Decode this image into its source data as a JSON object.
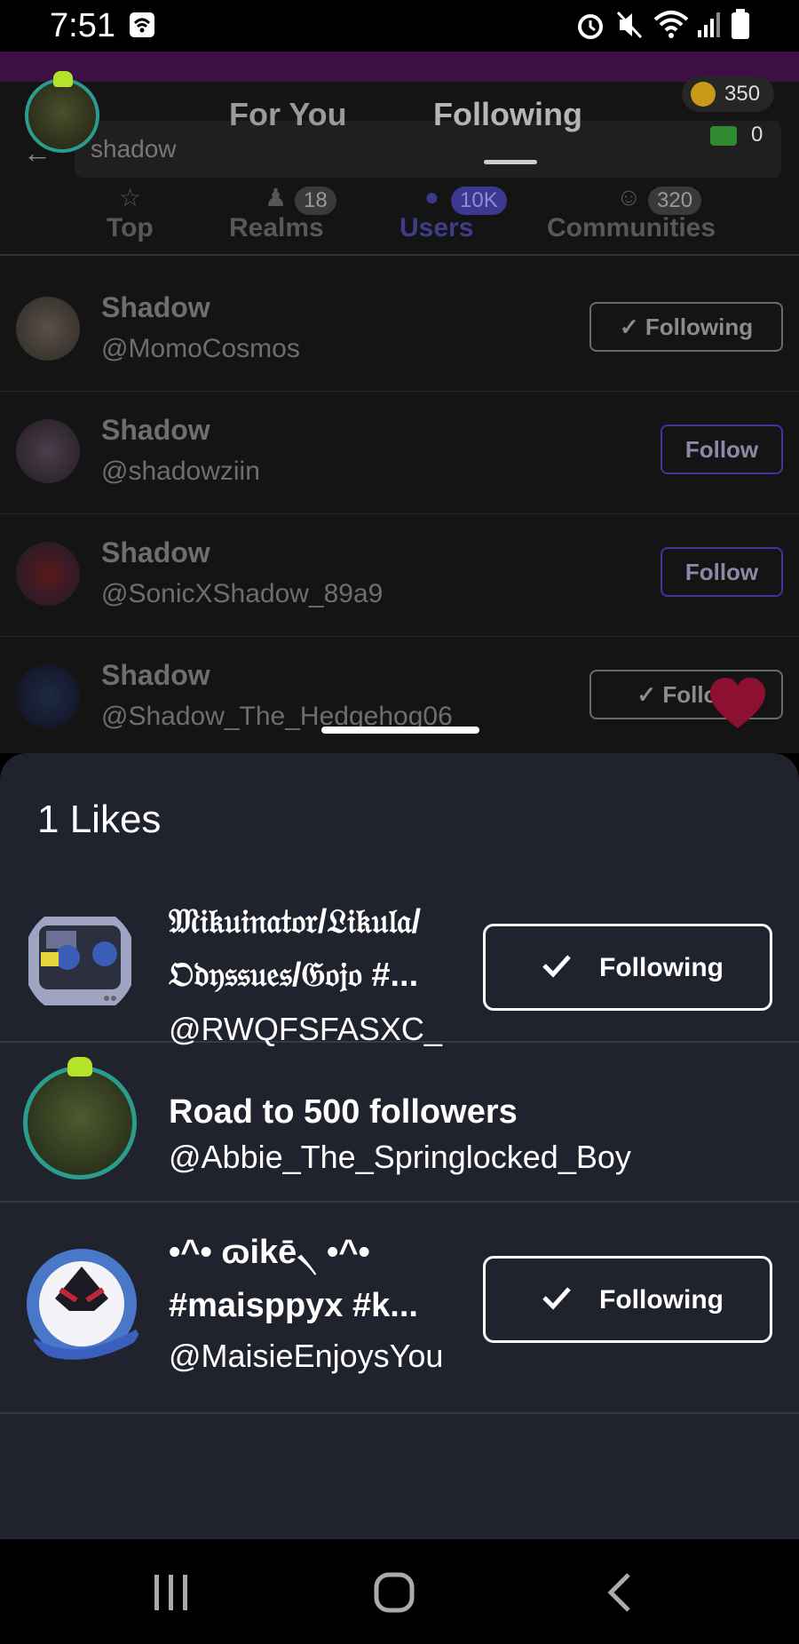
{
  "status_bar": {
    "time": "7:51"
  },
  "header": {
    "tabs": [
      "For You",
      "Following"
    ],
    "search_query": "shadow",
    "coins": "350",
    "cash": "0"
  },
  "categories": [
    {
      "label": "Top",
      "count": ""
    },
    {
      "label": "Realms",
      "count": "18"
    },
    {
      "label": "Users",
      "count": "10K"
    },
    {
      "label": "Communities",
      "count": "320"
    }
  ],
  "search_results": [
    {
      "name": "Shadow",
      "handle": "@MomoCosmos",
      "button": "Following"
    },
    {
      "name": "Shadow",
      "handle": "@shadowziin",
      "button": "Follow"
    },
    {
      "name": "Shadow",
      "handle": "@SonicXShadow_89a9",
      "button": "Follow"
    },
    {
      "name": "Shadow",
      "handle": "@Shadow_The_Hedgehog06",
      "button": "Follow"
    }
  ],
  "likes_sheet": {
    "title": "1 Likes",
    "users": [
      {
        "name_line1": "𝔐𝔦𝔨𝔲𝔦𝔫𝔞𝔱𝔬𝔯/𝔏𝔦𝔨𝔲𝔩𝔞/",
        "name_line2": "𝔒𝔡𝔶𝔰𝔰𝔲𝔢𝔰/𝔊𝔬𝔧𝔬 #...",
        "handle": "@RWQFSFASXC_",
        "button": "Following"
      },
      {
        "name_line1": "Road to 500 followers",
        "name_line2": "",
        "handle": "@Abbie_The_Springlocked_Boy",
        "button": ""
      },
      {
        "name_line1": "•^• ɷikē৲ •^•",
        "name_line2": "#maisppyx #k...",
        "handle": "@MaisieEnjoysYou",
        "button": "Following"
      }
    ]
  },
  "colors": {
    "sheet_bg": "#20232e",
    "accent_purple": "#3b3890",
    "heart": "#8d1030"
  }
}
